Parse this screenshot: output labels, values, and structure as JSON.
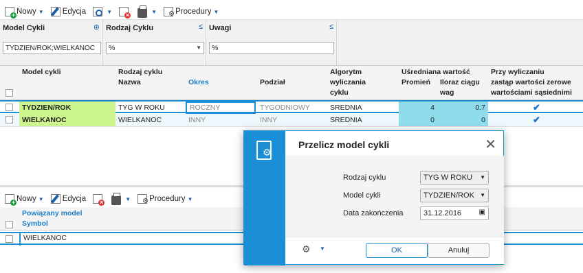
{
  "toolbar": {
    "new_label": "Nowy",
    "edit_label": "Edycja",
    "procedures_label": "Procedury"
  },
  "filters": {
    "model_label": "Model Cykli",
    "model_value": "TYDZIEN/ROK;WIELKANOC",
    "kind_label": "Rodzaj Cyklu",
    "kind_value": "%",
    "notes_label": "Uwagi",
    "notes_value": "%"
  },
  "grid": {
    "headers": {
      "model": "Model cykli",
      "kind_group": "Rodzaj cyklu",
      "name": "Nazwa",
      "period": "Okres",
      "split": "Podział",
      "algorithm": "Algorytm wyliczania cyklu",
      "avg_group": "Uśredniana wartość",
      "radius": "Promień",
      "weights": "Iloraz ciągu wag",
      "replace_group": "Przy wyliczaniu",
      "replace_sub": "zastąp wartości zerowe wartościami sąsiednimi"
    },
    "rows": [
      {
        "model": "TYDZIEN/ROK",
        "name": "TYG W ROKU",
        "period": "ROCZNY",
        "split": "TYGODNIOWY",
        "algorithm": "SREDNIA",
        "radius": "4",
        "weights": "0.7",
        "replace": true
      },
      {
        "model": "WIELKANOC",
        "name": "WIELKANOC",
        "period": "INNY",
        "split": "INNY",
        "algorithm": "SREDNIA",
        "radius": "0",
        "weights": "0",
        "replace": true
      }
    ]
  },
  "lower": {
    "new_label": "Nowy",
    "edit_label": "Edycja",
    "procedures_label": "Procedury",
    "header_group": "Powiązany model",
    "header_symbol": "Symbol",
    "rows": [
      "WIELKANOC"
    ]
  },
  "dialog": {
    "title": "Przelicz model cykli",
    "kind_label": "Rodzaj cyklu",
    "kind_value": "TYG W ROKU",
    "model_label": "Model cykli",
    "model_value": "TYDZIEN/ROK",
    "date_label": "Data zakończenia",
    "date_value": "31.12.2016",
    "ok_label": "OK",
    "cancel_label": "Anuluj"
  },
  "colors": {
    "accent": "#1a8fd6",
    "model_highlight": "#ccf58f",
    "numeric_highlight": "#8fdcec"
  }
}
